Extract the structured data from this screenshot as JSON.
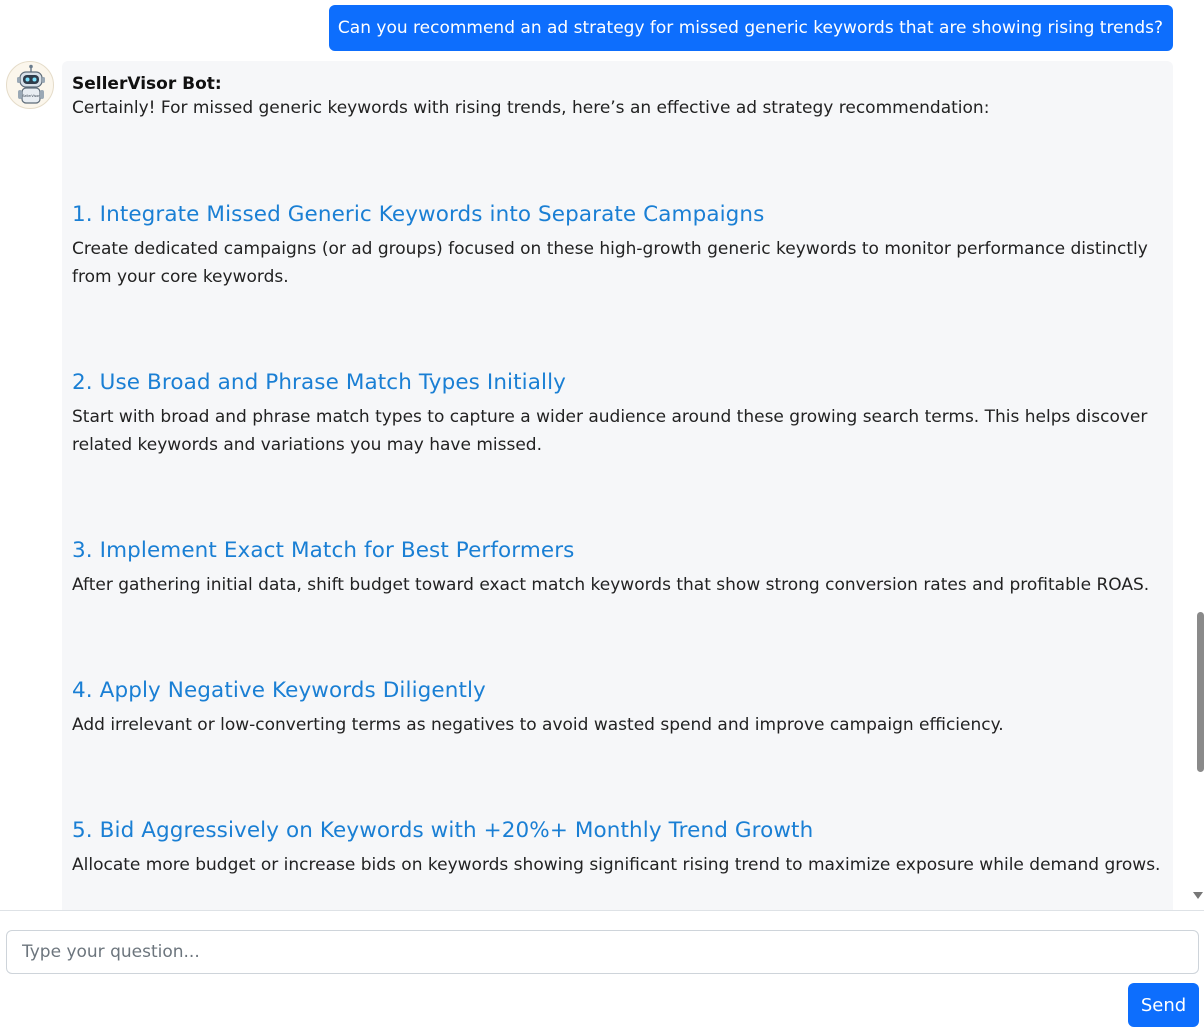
{
  "chat": {
    "user_message": "Can you recommend an ad strategy for missed generic keywords that are showing rising trends?",
    "bot": {
      "name": "SellerVisor Bot:",
      "avatar_icon": "robot-icon",
      "avatar_text": "SellerVisor",
      "intro": "Certainly! For missed generic keywords with rising trends, here’s an effective ad strategy recommendation:",
      "items": [
        {
          "heading": "1. Integrate Missed Generic Keywords into Separate Campaigns",
          "body": "Create dedicated campaigns (or ad groups) focused on these high-growth generic keywords to monitor performance distinctly from your core keywords."
        },
        {
          "heading": "2. Use Broad and Phrase Match Types Initially",
          "body": "Start with broad and phrase match types to capture a wider audience around these growing search terms. This helps discover related keywords and variations you may have missed."
        },
        {
          "heading": "3. Implement Exact Match for Best Performers",
          "body": "After gathering initial data, shift budget toward exact match keywords that show strong conversion rates and profitable ROAS."
        },
        {
          "heading": "4. Apply Negative Keywords Diligently",
          "body": "Add irrelevant or low-converting terms as negatives to avoid wasted spend and improve campaign efficiency."
        },
        {
          "heading": "5. Bid Aggressively on Keywords with +20%+ Monthly Trend Growth",
          "body": "Allocate more budget or increase bids on keywords showing significant rising trend to maximize exposure while demand grows."
        }
      ]
    }
  },
  "composer": {
    "placeholder": "Type your question...",
    "send_label": "Send"
  },
  "colors": {
    "primary": "#0d6efd",
    "heading": "#1a7fd4",
    "bubble_bg": "#f6f7f9"
  }
}
